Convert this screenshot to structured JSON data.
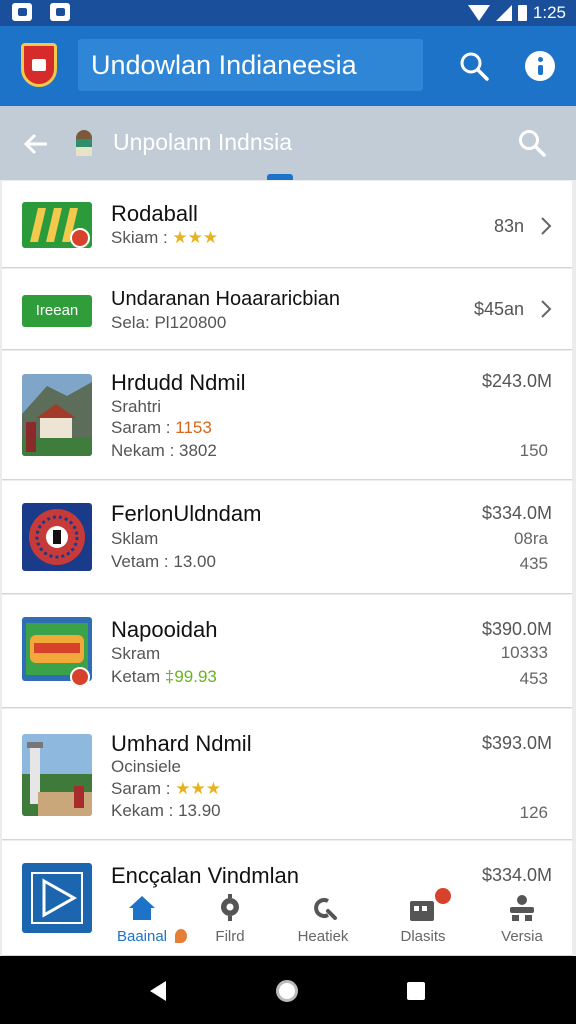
{
  "status_bar": {
    "time": "1:25"
  },
  "app_bar": {
    "title": "Undowlan Indianeesia"
  },
  "search_header": {
    "title": "Unpolann Indnsia"
  },
  "items": [
    {
      "name": "Rodaball",
      "line1_prefix": "Skiam : ",
      "line1_stars": "★★★",
      "price": "83n"
    },
    {
      "name": "Undaranan Hoaararicbian",
      "line1": "Sela: Pl120800",
      "price": "$45an",
      "thumb_text": "Ireean"
    },
    {
      "name": "Hrdudd Ndmil",
      "line1": "Srahtri",
      "line2_prefix": "Saram : ",
      "line2_value": "1153",
      "line3": "Nekam : 3802",
      "price": "$243.0M",
      "price_sub": "150"
    },
    {
      "name": "FerlonUldndam",
      "line1": "Sklam",
      "line2": "Vetam : 13.00",
      "price": "$334.0M",
      "price_sub": "08ra",
      "price_sub2": "435"
    },
    {
      "name": "Napooidah",
      "line1": "Skram",
      "line2_prefix": "Ketam ",
      "line2_value": "‡99.93",
      "price": "$390.0M",
      "price_sub": "10333",
      "price_sub2": "453"
    },
    {
      "name": "Umhard Ndmil",
      "line1": "Ocinsiele",
      "line2_prefix": "Saram : ",
      "line2_stars": "★★★",
      "line3": "Kekam : 13.90",
      "price": "$393.0M",
      "price_sub": "126"
    },
    {
      "name": "Encçalan Vindmlan",
      "price": "$334.0M"
    }
  ],
  "bottom_nav": [
    {
      "label": "Baainal",
      "icon": "home-icon"
    },
    {
      "label": "Filrd",
      "icon": "location-pin-icon"
    },
    {
      "label": "Heatiek",
      "icon": "link-icon"
    },
    {
      "label": "Dlasits",
      "icon": "calendar-icon",
      "badge": true
    },
    {
      "label": "Versia",
      "icon": "person-group-icon"
    }
  ],
  "colors": {
    "primary": "#1c73c8",
    "status_bar": "#1a4f9c",
    "subheader": "#c1ccd6",
    "badge": "#d8412b",
    "stars": "#e6b422"
  }
}
